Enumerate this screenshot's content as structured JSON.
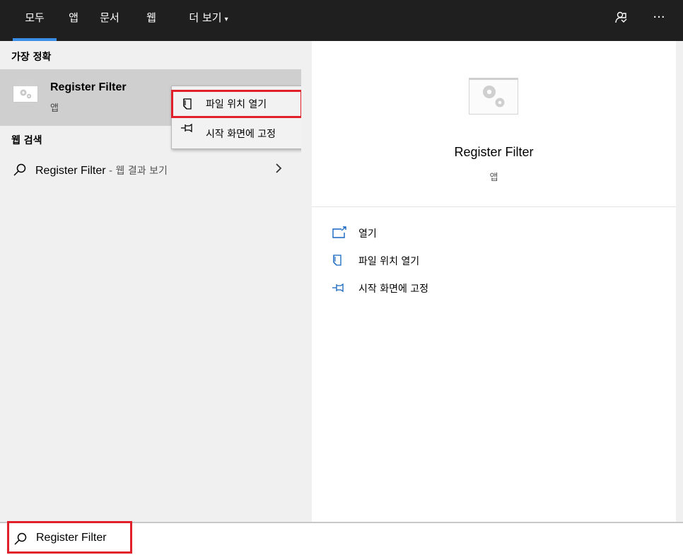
{
  "tabs": [
    {
      "label": "모두"
    },
    {
      "label": "앱"
    },
    {
      "label": "문서"
    },
    {
      "label": "웹"
    },
    {
      "label": "더 보기"
    }
  ],
  "more_caret": "▾",
  "top_icons": {
    "feedback": "feedback-icon",
    "more": "···"
  },
  "left": {
    "best_match_header": "가장 정확",
    "best_match": {
      "name": "Register Filter",
      "type": "앱"
    },
    "web_header": "웹 검색",
    "web_result": {
      "query": "Register Filter",
      "suffix": " - 웹 결과 보기"
    }
  },
  "context_menu": {
    "items": [
      {
        "label": "파일 위치 열기",
        "icon": "folder-icon"
      },
      {
        "label": "시작 화면에 고정",
        "icon": "pin-icon"
      }
    ]
  },
  "right": {
    "title": "Register Filter",
    "subtitle": "앱",
    "actions": [
      {
        "label": "열기",
        "icon": "open-icon"
      },
      {
        "label": "파일 위치 열기",
        "icon": "folder-icon"
      },
      {
        "label": "시작 화면에 고정",
        "icon": "pin-icon"
      }
    ]
  },
  "search": {
    "value": "Register Filter"
  },
  "colors": {
    "accent": "#3a8ee6",
    "highlight": "#e0202a",
    "topbar": "#1f1f1f"
  }
}
